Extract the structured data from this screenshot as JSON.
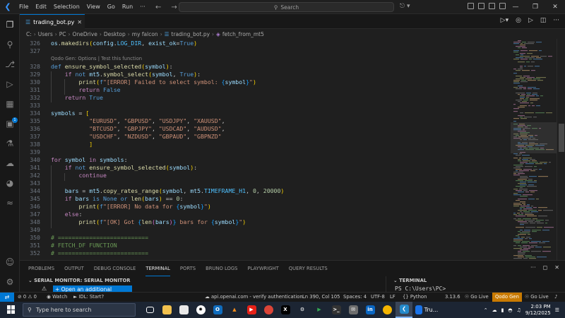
{
  "titlebar": {
    "menu": [
      "File",
      "Edit",
      "Selection",
      "View",
      "Go",
      "Run",
      "···"
    ],
    "search_placeholder": "Search"
  },
  "tab": {
    "filename": "trading_bot.py",
    "lang": "py"
  },
  "breadcrumb": [
    "C:",
    "Users",
    "PC",
    "OneDrive",
    "Desktop",
    "my falcon",
    "trading_bot.py",
    "fetch_from_mt5"
  ],
  "editor": {
    "codelens": "Qodo Gen: Options | Test this function",
    "line_numbers": [
      "326",
      "327",
      "328",
      "329",
      "330",
      "331",
      "332",
      "333",
      "334",
      "335",
      "336",
      "337",
      "338",
      "339",
      "340",
      "341",
      "342",
      "343",
      "344",
      "345",
      "346",
      "347",
      "348",
      "349",
      "350",
      "351",
      "352"
    ]
  },
  "panel": {
    "tabs": [
      "PROBLEMS",
      "OUTPUT",
      "DEBUG CONSOLE",
      "TERMINAL",
      "PORTS",
      "BRUNO LOGS",
      "PLAYWRIGHT",
      "QUERY RESULTS"
    ],
    "active_tab": "TERMINAL",
    "serial_header": "SERIAL MONITOR: SERIAL MONITOR",
    "serial_button": "+ Open an additional monitor",
    "terminal_header": "TERMINAL",
    "terminal_prompt": "PS C:\\Users\\PC>"
  },
  "statusbar": {
    "errors": "0",
    "warnings": "0",
    "watch": "Watch",
    "idl": "IDL: Start?",
    "auth": "api.openai.com - verify authentication",
    "position": "Ln 390, Col 105",
    "spaces": "Spaces: 4",
    "encoding": "UTF-8",
    "eol": "LF",
    "language": "Python",
    "py_version": "3.13.6",
    "golive1": "Go Live",
    "qodo": "Qodo Gen",
    "golive2": "Go Live"
  },
  "taskbar": {
    "search_placeholder": "Type here to search",
    "pinned_label": "Tru...",
    "time": "2:03 PM",
    "date": "9/12/2025"
  },
  "colors": {
    "accent": "#0078d4",
    "qodo": "#c97a00"
  }
}
